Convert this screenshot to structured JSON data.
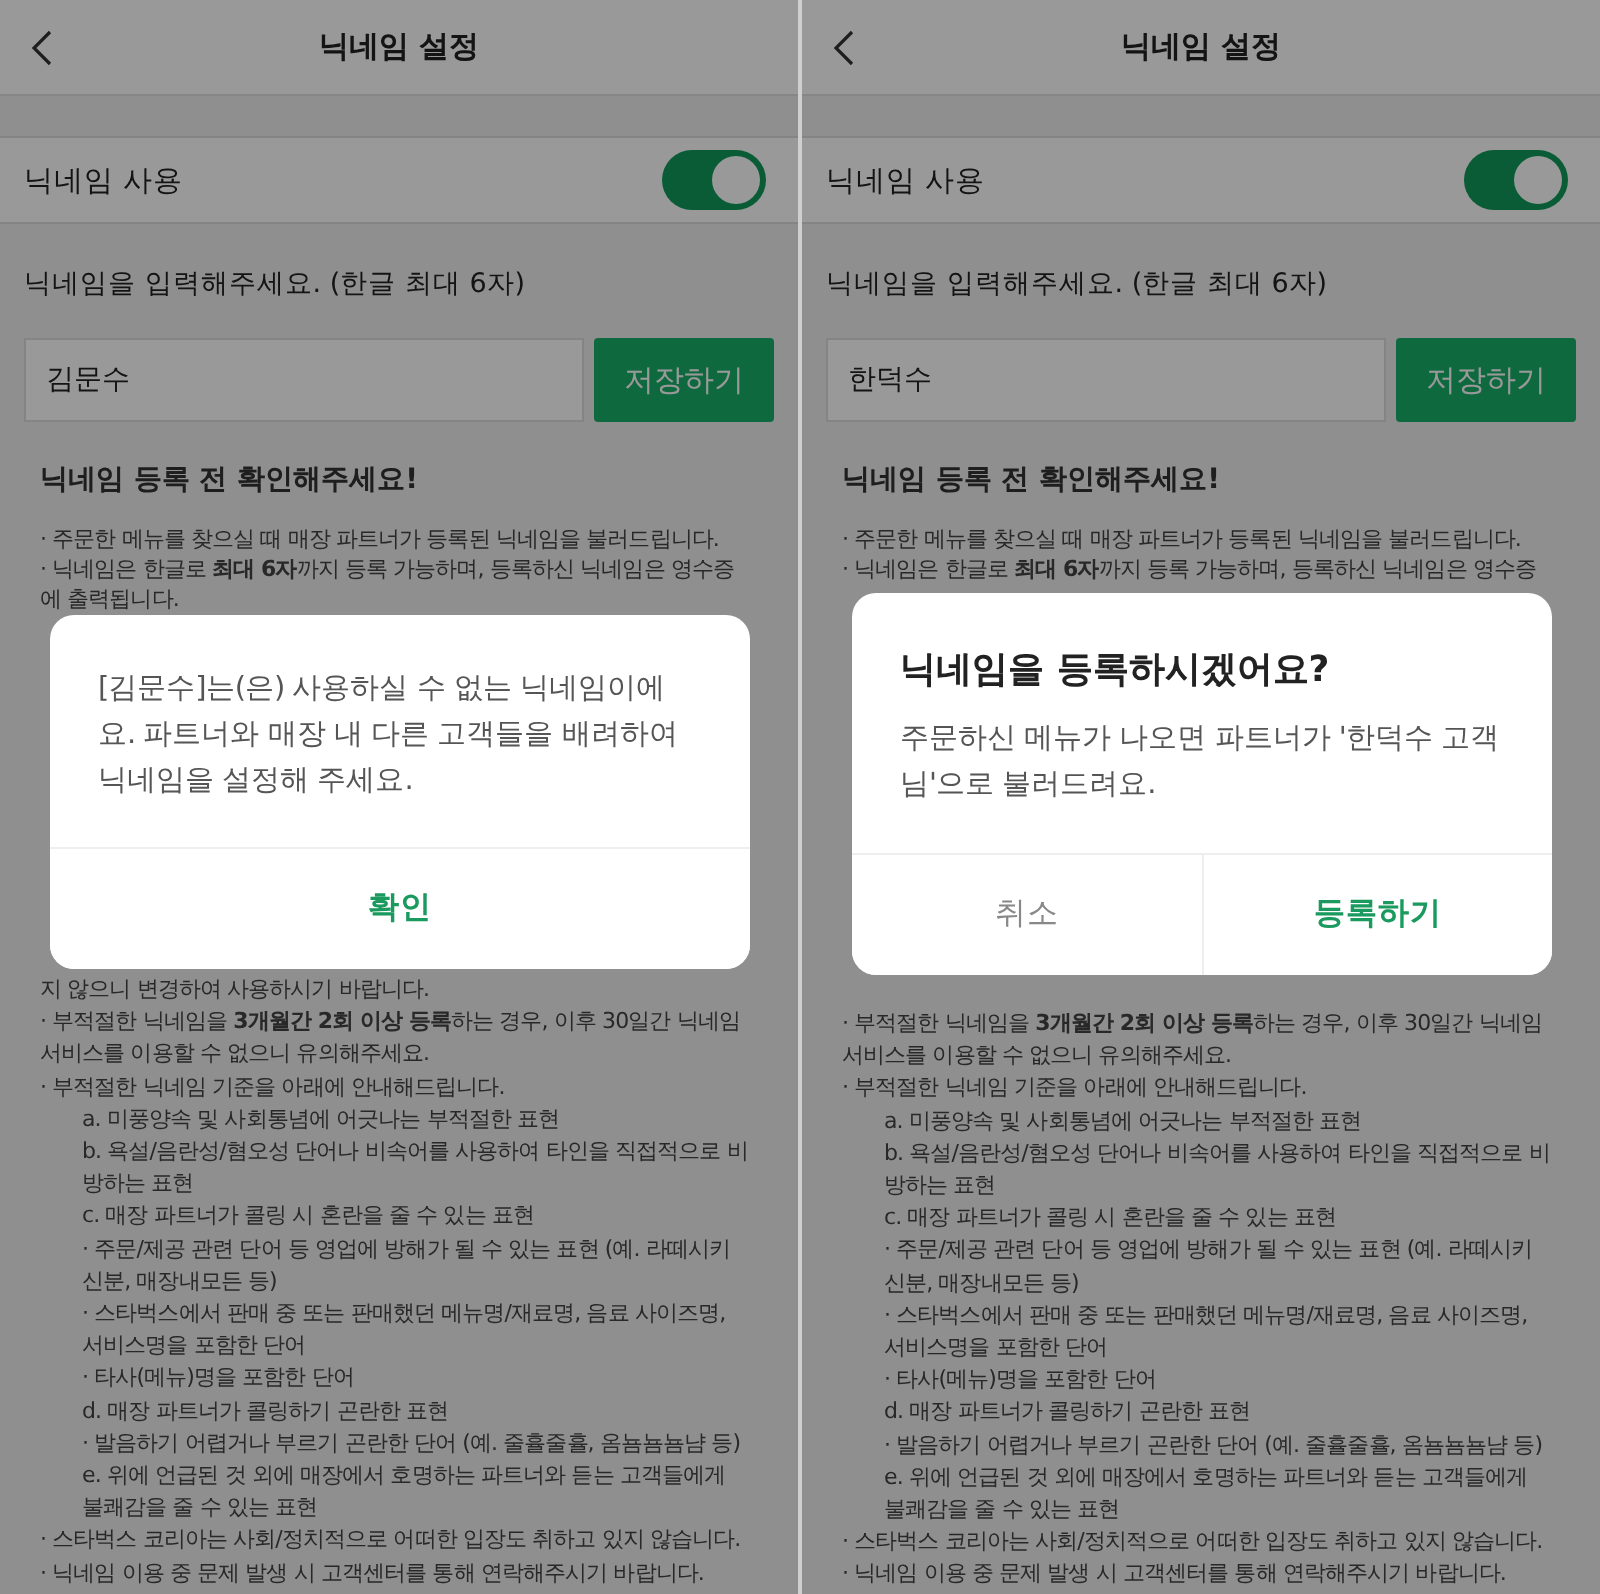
{
  "panels": [
    {
      "header": {
        "title": "닉네임 설정"
      },
      "toggle_row": {
        "label": "닉네임 사용",
        "on": true
      },
      "input_label": "닉네임을 입력해주세요. (한글 최대 6자)",
      "nickname_field": {
        "value": "김문수"
      },
      "save_button": "저장하기",
      "notice_title": "닉네임 등록 전 확인해주세요!",
      "notice_before": [
        {
          "kind": "main",
          "text": "· 주문한 메뉴를 찾으실 때 매장 파트너가 등록된 닉네임을 불러드립니다."
        },
        {
          "kind": "main",
          "text": "· 닉네임은 한글로 **최대 6자**까지 등록 가능하며, 등록하신 닉네임은 영수증에 출력됩니다."
        }
      ],
      "notice_after": [
        {
          "kind": "main",
          "text": "지 않으니 변경하여 사용하시기 바랍니다."
        },
        {
          "kind": "main",
          "text": "· 부적절한 닉네임을 **3개월간 2회 이상 등록**하는 경우, 이후 30일간 닉네임 서비스를 이용할 수 없으니 유의해주세요."
        },
        {
          "kind": "main",
          "text": "· 부적절한 닉네임 기준을 아래에 안내해드립니다."
        },
        {
          "kind": "sub",
          "text": "a. 미풍양속 및 사회통념에 어긋나는 부적절한 표현"
        },
        {
          "kind": "sub",
          "text": "b. 욕설/음란성/혐오성 단어나 비속어를 사용하여 타인을 직접적으로 비방하는 표현"
        },
        {
          "kind": "sub",
          "text": "c. 매장 파트너가 콜링 시 혼란을 줄 수 있는 표현"
        },
        {
          "kind": "sub",
          "text": "· 주문/제공 관련 단어 등 영업에 방해가 될 수 있는 표현 (예. 라떼시키신분, 매장내모든 등)"
        },
        {
          "kind": "sub",
          "text": "· 스타벅스에서 판매 중 또는 판매했던 메뉴명/재료명, 음료 사이즈명, 서비스명을 포함한 단어"
        },
        {
          "kind": "sub",
          "text": "· 타사(메뉴)명을 포함한 단어"
        },
        {
          "kind": "sub",
          "text": "d. 매장 파트너가 콜링하기 곤란한 표현"
        },
        {
          "kind": "sub",
          "text": "· 발음하기 어렵거나 부르기 곤란한 단어 (예. 줄휼줄휼, 옴뇸뇸뇸냠 등)"
        },
        {
          "kind": "sub",
          "text": "e. 위에 언급된 것 외에 매장에서 호명하는 파트너와 듣는 고객들에게 불쾌감을 줄 수 있는 표현"
        },
        {
          "kind": "main",
          "text": "· 스타벅스 코리아는 사회/정치적으로 어떠한 입장도 취하고 있지 않습니다."
        },
        {
          "kind": "main",
          "text": "· 닉네임 이용 중 문제 발생 시 고객센터를 통해 연락해주시기 바랍니다."
        }
      ],
      "dialog": {
        "kind": "alert",
        "message": "[김문수]는(은) 사용하실 수 없는 닉네임이에요. 파트너와 매장 내 다른 고객들을 배려하여 닉네임을 설정해 주세요.",
        "buttons": [
          {
            "label": "확인",
            "kind": "primary"
          }
        ]
      }
    },
    {
      "header": {
        "title": "닉네임 설정"
      },
      "toggle_row": {
        "label": "닉네임 사용",
        "on": true
      },
      "input_label": "닉네임을 입력해주세요. (한글 최대 6자)",
      "nickname_field": {
        "value": "한덕수"
      },
      "save_button": "저장하기",
      "notice_title": "닉네임 등록 전 확인해주세요!",
      "notice_before": [
        {
          "kind": "main",
          "text": "· 주문한 메뉴를 찾으실 때 매장 파트너가 등록된 닉네임을 불러드립니다."
        },
        {
          "kind": "main",
          "text": "· 닉네임은 한글로 **최대 6자**까지 등록 가능하며, 등록하신 닉네임은 영수증"
        }
      ],
      "notice_after": [
        {
          "kind": "main",
          "text": "· 부적절한 닉네임을 **3개월간 2회 이상 등록**하는 경우, 이후 30일간 닉네임 서비스를 이용할 수 없으니 유의해주세요."
        },
        {
          "kind": "main",
          "text": "· 부적절한 닉네임 기준을 아래에 안내해드립니다."
        },
        {
          "kind": "sub",
          "text": "a. 미풍양속 및 사회통념에 어긋나는 부적절한 표현"
        },
        {
          "kind": "sub",
          "text": "b. 욕설/음란성/혐오성 단어나 비속어를 사용하여 타인을 직접적으로 비방하는 표현"
        },
        {
          "kind": "sub",
          "text": "c. 매장 파트너가 콜링 시 혼란을 줄 수 있는 표현"
        },
        {
          "kind": "sub",
          "text": "· 주문/제공 관련 단어 등 영업에 방해가 될 수 있는 표현 (예. 라떼시키신분, 매장내모든 등)"
        },
        {
          "kind": "sub",
          "text": "· 스타벅스에서 판매 중 또는 판매했던 메뉴명/재료명, 음료 사이즈명, 서비스명을 포함한 단어"
        },
        {
          "kind": "sub",
          "text": "· 타사(메뉴)명을 포함한 단어"
        },
        {
          "kind": "sub",
          "text": "d. 매장 파트너가 콜링하기 곤란한 표현"
        },
        {
          "kind": "sub",
          "text": "· 발음하기 어렵거나 부르기 곤란한 단어 (예. 줄휼줄휼, 옴뇸뇸뇸냠 등)"
        },
        {
          "kind": "sub",
          "text": "e. 위에 언급된 것 외에 매장에서 호명하는 파트너와 듣는 고객들에게 불쾌감을 줄 수 있는 표현"
        },
        {
          "kind": "main",
          "text": "· 스타벅스 코리아는 사회/정치적으로 어떠한 입장도 취하고 있지 않습니다."
        },
        {
          "kind": "main",
          "text": "· 닉네임 이용 중 문제 발생 시 고객센터를 통해 연락해주시기 바랍니다."
        }
      ],
      "dialog": {
        "kind": "confirm",
        "title": "닉네임을 등록하시겠어요?",
        "message": "주문하신 메뉴가 나오면 파트너가 '한덕수 고객님'으로 불러드려요.",
        "buttons": [
          {
            "label": "취소",
            "kind": "secondary"
          },
          {
            "label": "등록하기",
            "kind": "primary"
          }
        ]
      }
    }
  ]
}
